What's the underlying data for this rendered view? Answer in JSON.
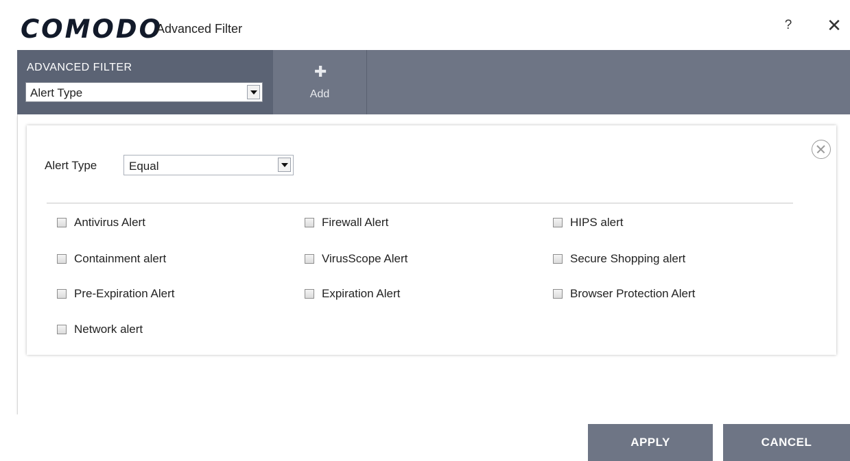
{
  "window": {
    "brand": "COMODO",
    "title": "Advanced Filter",
    "help_label": "?",
    "close_label": "✕"
  },
  "toolbar": {
    "filter_label": "ADVANCED FILTER",
    "filter_selected": "Alert Type",
    "add_icon": "✚",
    "add_label": "Add"
  },
  "condition": {
    "label": "Alert Type",
    "operator_selected": "Equal",
    "options": [
      "Antivirus Alert",
      "Firewall Alert",
      "HIPS alert",
      "Containment alert",
      "VirusScope Alert",
      "Secure Shopping alert",
      "Pre-Expiration Alert",
      "Expiration Alert",
      "Browser Protection Alert",
      "Network alert"
    ]
  },
  "footer": {
    "apply_label": "APPLY",
    "cancel_label": "CANCEL"
  },
  "colors": {
    "toolbar_bg": "#6e7585",
    "toolbar_active_bg": "#5b6374",
    "button_bg": "#6e7585"
  }
}
